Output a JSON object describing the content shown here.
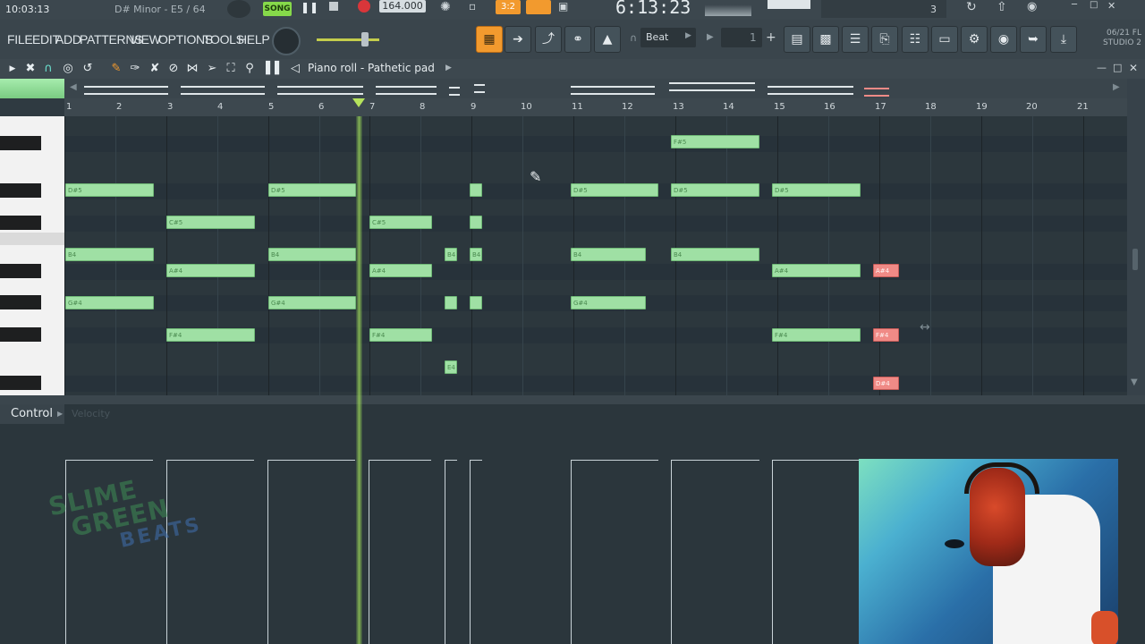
{
  "transport": {
    "clock": "10:03:13",
    "hint": "D# Minor - E5 / 64",
    "song_mode": "SONG",
    "tempo": "164.000",
    "time_display": "6:13:23",
    "pattern_num": "3",
    "snap_ratio": "3:2"
  },
  "menu": [
    "FILE",
    "EDIT",
    "ADD",
    "PATTERNS",
    "VIEW",
    "OPTIONS",
    "TOOLS",
    "HELP"
  ],
  "toolbar": {
    "snap_label": "Beat",
    "step": "1",
    "version_date": "06/21",
    "version_fl": "FL",
    "version_studio": "STUDIO 2"
  },
  "piano_roll": {
    "title": "Piano roll - Pathetic pad",
    "bars": [
      "1",
      "2",
      "3",
      "4",
      "5",
      "6",
      "7",
      "8",
      "9",
      "10",
      "11",
      "12",
      "13",
      "14",
      "15",
      "16",
      "17",
      "18",
      "19",
      "20",
      "21"
    ],
    "notes": [
      {
        "label": "D#5",
        "color": "green"
      },
      {
        "label": "C#5",
        "color": "green"
      },
      {
        "label": "B4",
        "color": "green"
      },
      {
        "label": "A#4",
        "color": "green"
      },
      {
        "label": "G#4",
        "color": "green"
      },
      {
        "label": "F#4",
        "color": "green"
      },
      {
        "label": "F#5",
        "color": "green"
      },
      {
        "label": "E4",
        "color": "green"
      },
      {
        "label": "A#4",
        "color": "red"
      },
      {
        "label": "F#4",
        "color": "red"
      },
      {
        "label": "D#4",
        "color": "red"
      }
    ]
  },
  "control": {
    "label": "Control",
    "sublabel": "Velocity"
  },
  "overlay": {
    "watermark_line1": "SLIME",
    "watermark_line2": "GREEN",
    "watermark_line3": "BEATS"
  },
  "colors": {
    "note_green": "#9fe0a4",
    "note_red": "#f08a86",
    "accent_orange": "#f29a2e",
    "playhead": "#a0dc5a"
  }
}
